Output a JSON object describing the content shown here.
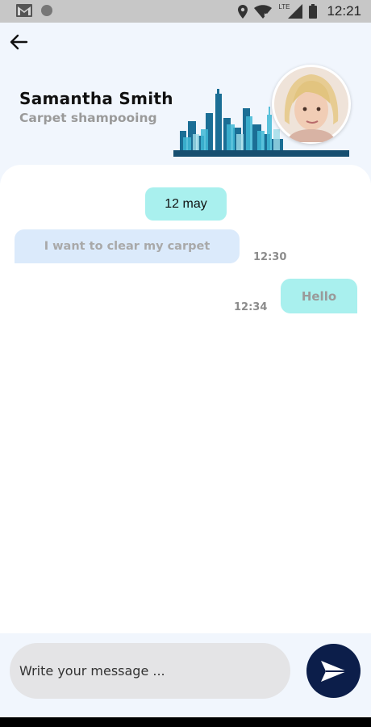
{
  "status_bar": {
    "time": "12:21",
    "network": "LTE",
    "icons": [
      "gmail-icon",
      "circle-notification-icon",
      "location-icon",
      "wifi-icon",
      "signal-icon",
      "battery-icon"
    ]
  },
  "header": {
    "back_icon": "arrow-left-icon",
    "contact_name": "Samantha Smith",
    "service": "Carpet shampooing"
  },
  "chat": {
    "date_label": "12 may",
    "messages": [
      {
        "direction": "incoming",
        "text": "I want to clear my carpet",
        "time": "12:30"
      },
      {
        "direction": "outgoing",
        "text": "Hello",
        "time": "12:34"
      }
    ]
  },
  "composer": {
    "placeholder": "Write your message ...",
    "value": "",
    "send_icon": "send-icon"
  },
  "colors": {
    "header_bg": "#f1f6fd",
    "accent_bubble": "#a9f0ee",
    "incoming_bubble": "#dbeafb",
    "send_button": "#0c1e4a",
    "skyline": "#1b6e95"
  }
}
